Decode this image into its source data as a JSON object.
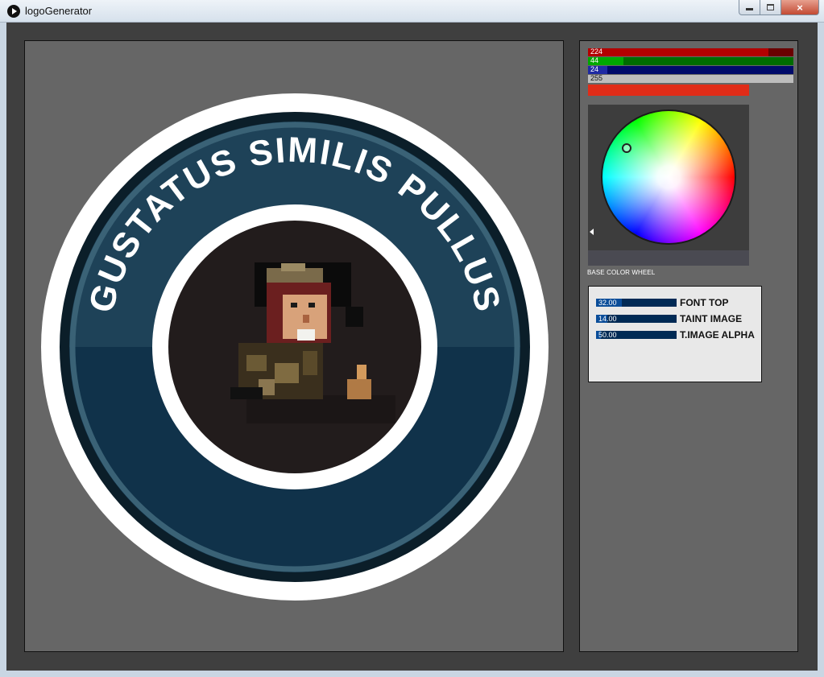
{
  "window": {
    "title": "logoGenerator",
    "controls": {
      "minimize": "minimize",
      "maximize": "maximize",
      "close": "×"
    }
  },
  "logo": {
    "top_text": "GUSTATUS SIMILIS PULLUS",
    "colors": {
      "outer_ring": "#ffffff",
      "band_dark": "#0b1e29",
      "band_upper": "#1e4258",
      "band_lower": "#10324a",
      "band_edge": "#3a6276",
      "center": "#221c1c",
      "text": "#ffffff"
    }
  },
  "color_sliders": [
    {
      "channel": "red",
      "label": "224",
      "value": 224,
      "max": 255
    },
    {
      "channel": "green",
      "label": "44",
      "value": 44,
      "max": 255
    },
    {
      "channel": "blue",
      "label": "24",
      "value": 24,
      "max": 255
    },
    {
      "channel": "alpha",
      "label": "255",
      "value": 255,
      "max": 255
    }
  ],
  "color_preview": "#e02c18",
  "color_wheel": {
    "caption": "BASE COLOR WHEEL"
  },
  "number_controls": [
    {
      "value": "32.00",
      "name": "FONT TOP",
      "fraction": 0.32
    },
    {
      "value": "14.00",
      "name": "TAINT IMAGE",
      "fraction": 0.14
    },
    {
      "value": "50.00",
      "name": "T.IMAGE ALPHA",
      "fraction": 0.06
    }
  ]
}
